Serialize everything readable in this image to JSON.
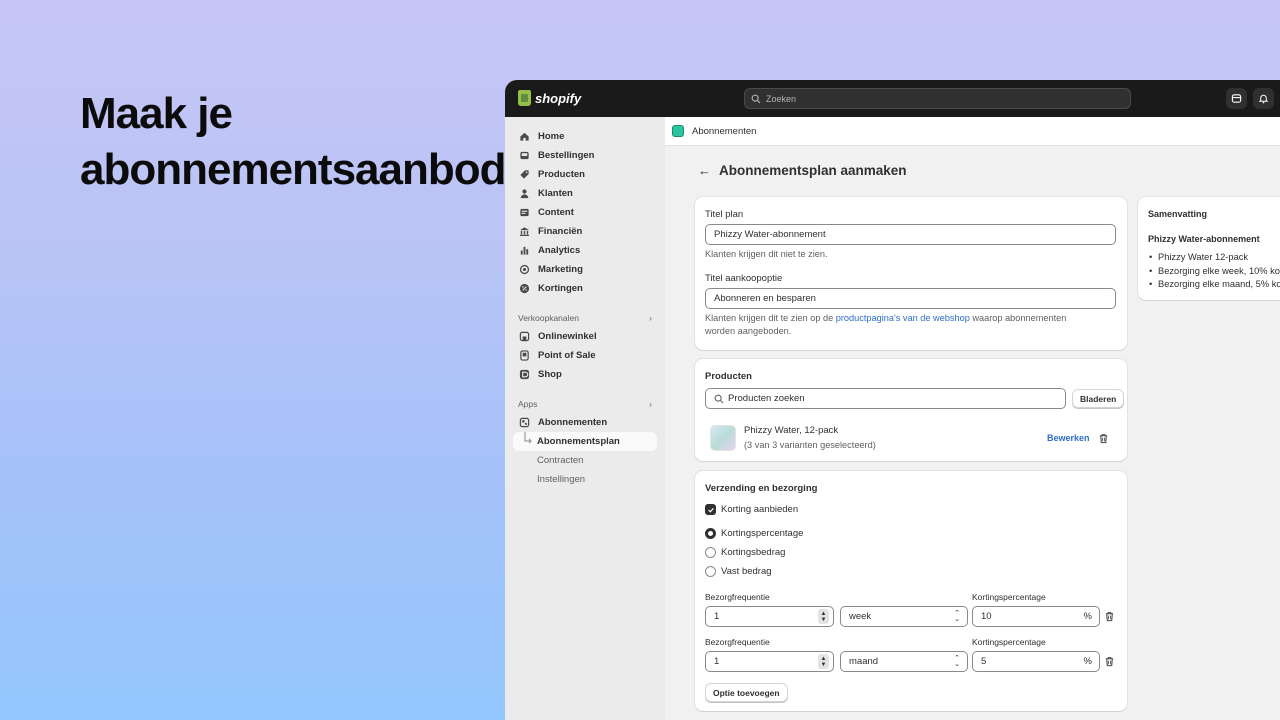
{
  "headline": "Maak je\nabonnementsaanbod",
  "topbar": {
    "brand": "shopify",
    "search_placeholder": "Zoeken"
  },
  "sidebar": {
    "items": [
      {
        "label": "Home",
        "icon": "home-icon"
      },
      {
        "label": "Bestellingen",
        "icon": "inbox-icon"
      },
      {
        "label": "Producten",
        "icon": "tag-icon"
      },
      {
        "label": "Klanten",
        "icon": "person-icon"
      },
      {
        "label": "Content",
        "icon": "content-icon"
      },
      {
        "label": "Financiën",
        "icon": "bank-icon"
      },
      {
        "label": "Analytics",
        "icon": "bar-chart-icon"
      },
      {
        "label": "Marketing",
        "icon": "target-icon"
      },
      {
        "label": "Kortingen",
        "icon": "discount-icon"
      }
    ],
    "sales_channels_label": "Verkoopkanalen",
    "channels": [
      {
        "label": "Onlinewinkel",
        "icon": "store-icon"
      },
      {
        "label": "Point of Sale",
        "icon": "pos-icon"
      },
      {
        "label": "Shop",
        "icon": "shop-icon"
      }
    ],
    "apps_label": "Apps",
    "apps": [
      {
        "label": "Abonnementen",
        "icon": "subscriptions-app-icon"
      }
    ],
    "app_subitems": [
      "Abonnementsplan",
      "Contracten",
      "Instellingen"
    ]
  },
  "appbar": {
    "title": "Abonnementen"
  },
  "page": {
    "title": "Abonnementsplan aanmaken"
  },
  "plan_card": {
    "title_label": "Titel plan",
    "title_value": "Phizzy Water-abonnement",
    "title_help": "Klanten krijgen dit niet te zien.",
    "option_label": "Titel aankoopoptie",
    "option_value": "Abonneren en besparen",
    "option_help_pre": "Klanten krijgen dit te zien op de ",
    "option_help_link": "productpagina's van de webshop",
    "option_help_post": " waarop abonnementen",
    "option_help_line2": "worden aangeboden."
  },
  "products_card": {
    "heading": "Producten",
    "search_placeholder": "Producten zoeken",
    "browse_button": "Bladeren",
    "product_name": "Phizzy Water, 12-pack",
    "product_variants": "(3 van 3 varianten geselecteerd)",
    "edit_link": "Bewerken"
  },
  "delivery_card": {
    "heading": "Verzending en bezorging",
    "offer_discount_label": "Korting aanbieden",
    "offer_discount_checked": true,
    "discount_types": [
      "Kortingspercentage",
      "Kortingsbedrag",
      "Vast bedrag"
    ],
    "selected_discount_type": "Kortingspercentage",
    "rows": [
      {
        "freq_label": "Bezorgfrequentie",
        "freq_value": "1",
        "unit": "week",
        "pct_label": "Kortingspercentage",
        "pct_value": "10",
        "pct_suffix": "%"
      },
      {
        "freq_label": "Bezorgfrequentie",
        "freq_value": "1",
        "unit": "maand",
        "pct_label": "Kortingspercentage",
        "pct_value": "5",
        "pct_suffix": "%"
      }
    ],
    "add_option_button": "Optie toevoegen"
  },
  "summary": {
    "heading": "Samenvatting",
    "plan_name": "Phizzy Water-abonnement",
    "lines": [
      "Phizzy Water 12-pack",
      "Bezorging elke week, 10% korting",
      "Bezorging elke maand, 5% korting"
    ]
  }
}
